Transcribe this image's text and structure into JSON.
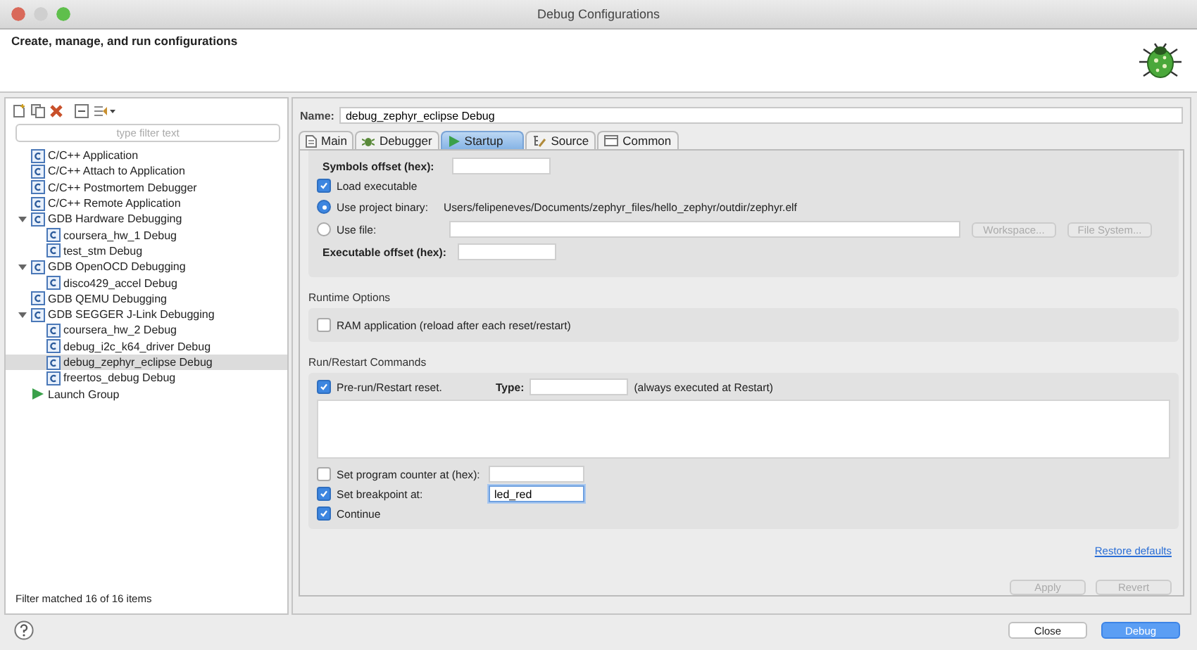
{
  "window": {
    "title": "Debug Configurations"
  },
  "header": {
    "title": "Create, manage, and run configurations"
  },
  "filter": {
    "placeholder": "type filter text"
  },
  "tree": [
    {
      "label": "C/C++ Application",
      "kind": "config",
      "selected": false
    },
    {
      "label": "C/C++ Attach to Application",
      "kind": "config",
      "selected": false
    },
    {
      "label": "C/C++ Postmortem Debugger",
      "kind": "config",
      "selected": false
    },
    {
      "label": "C/C++ Remote Application",
      "kind": "config",
      "selected": false
    },
    {
      "label": "GDB Hardware Debugging",
      "kind": "config",
      "selected": false,
      "expanded": true,
      "children": [
        {
          "label": "coursera_hw_1 Debug",
          "kind": "config",
          "selected": false
        },
        {
          "label": "test_stm Debug",
          "kind": "config",
          "selected": false
        }
      ]
    },
    {
      "label": "GDB OpenOCD Debugging",
      "kind": "config",
      "selected": false,
      "expanded": true,
      "children": [
        {
          "label": "disco429_accel Debug",
          "kind": "config",
          "selected": false
        }
      ]
    },
    {
      "label": "GDB QEMU Debugging",
      "kind": "config",
      "selected": false
    },
    {
      "label": "GDB SEGGER J-Link Debugging",
      "kind": "config",
      "selected": false,
      "expanded": true,
      "children": [
        {
          "label": "coursera_hw_2 Debug",
          "kind": "config",
          "selected": false
        },
        {
          "label": "debug_i2c_k64_driver Debug",
          "kind": "config",
          "selected": false
        },
        {
          "label": "debug_zephyr_eclipse Debug",
          "kind": "config",
          "selected": true
        },
        {
          "label": "freertos_debug Debug",
          "kind": "config",
          "selected": false
        }
      ]
    },
    {
      "label": "Launch Group",
      "kind": "launch",
      "selected": false
    }
  ],
  "filter_status": "Filter matched 16 of 16 items",
  "name": {
    "label": "Name:",
    "value": "debug_zephyr_eclipse Debug"
  },
  "tabs": [
    {
      "label": "Main",
      "kind": "main",
      "selected": false
    },
    {
      "label": "Debugger",
      "kind": "debugger",
      "selected": false
    },
    {
      "label": "Startup",
      "kind": "startup",
      "selected": true
    },
    {
      "label": "Source",
      "kind": "source",
      "selected": false
    },
    {
      "label": "Common",
      "kind": "common",
      "selected": false
    }
  ],
  "startup": {
    "symbols_offset_label": "Symbols offset (hex):",
    "load_executable": {
      "label": "Load executable",
      "checked": true
    },
    "binary_options": [
      {
        "label": "Use project binary:",
        "selected": true,
        "value": "Users/felipeneves/Documents/zephyr_files/hello_zephyr/outdir/zephyr.elf"
      },
      {
        "label": "Use file:",
        "selected": false
      }
    ],
    "file_buttons": [
      {
        "label": "Workspace...",
        "disabled": true
      },
      {
        "label": "File System...",
        "disabled": true
      }
    ],
    "executable_offset_label": "Executable offset (hex):"
  },
  "runtime_options": {
    "title": "Runtime Options",
    "ram_application": {
      "label": "RAM application (reload after each reset/restart)",
      "checked": false
    }
  },
  "run_restart": {
    "title": "Run/Restart Commands",
    "pre_run": {
      "label": "Pre-run/Restart reset.",
      "checked": true
    },
    "type_label": "Type:",
    "type_note": "(always executed at Restart)",
    "program_counter": {
      "label": "Set program counter at (hex):",
      "checked": false
    },
    "breakpoint": {
      "label": "Set breakpoint at:",
      "checked": true,
      "value": "led_red"
    },
    "continue": {
      "label": "Continue",
      "checked": true
    }
  },
  "restore_defaults": "Restore defaults",
  "panel_buttons": [
    {
      "label": "Apply",
      "disabled": true
    },
    {
      "label": "Revert",
      "disabled": true
    }
  ],
  "dialog_buttons": [
    {
      "label": "Close",
      "kind": "secondary"
    },
    {
      "label": "Debug",
      "kind": "primary"
    }
  ]
}
